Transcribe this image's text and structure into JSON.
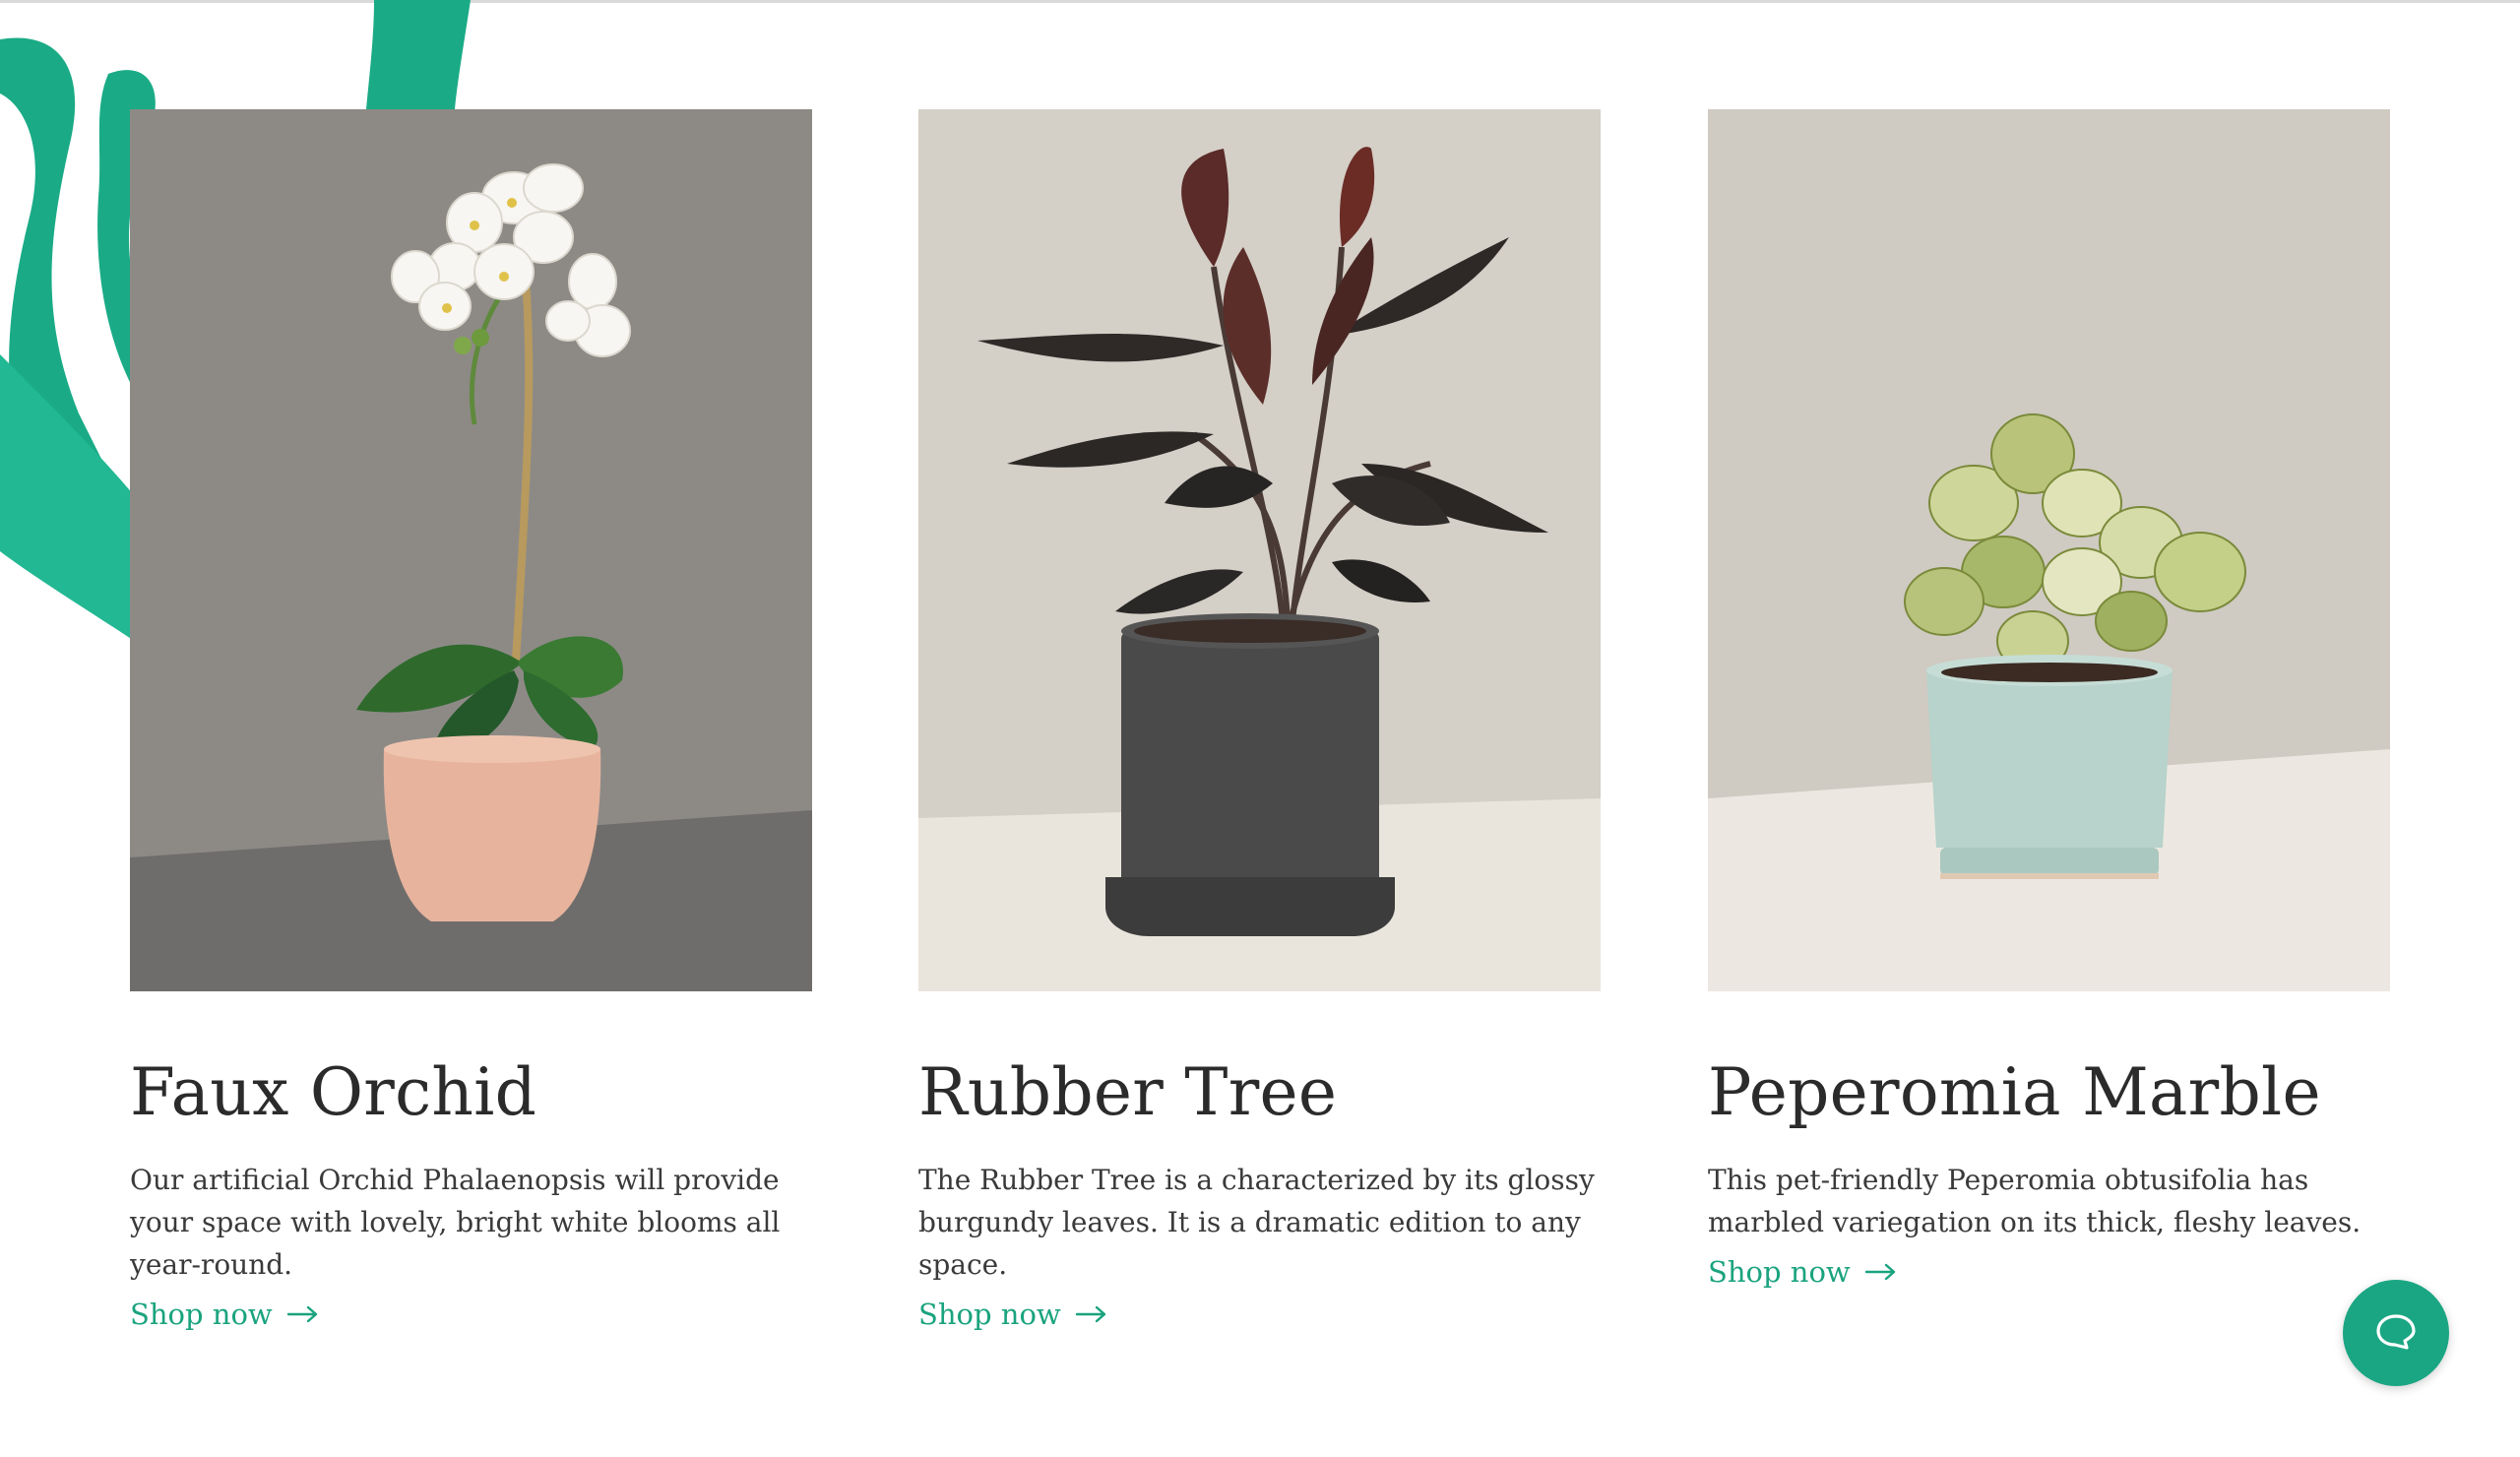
{
  "colors": {
    "accent": "#1aa37e",
    "decor_green": "#1aab86",
    "text": "#2b2b2b"
  },
  "products": [
    {
      "title": "Faux Orchid",
      "description": "Our artificial Orchid Phalaenopsis will provide your space with lovely, bright white blooms all year-round.",
      "link_label": "Shop now",
      "link_icon": "arrow-right-icon",
      "pot_color": "#e7b39d"
    },
    {
      "title": "Rubber Tree",
      "description": "The Rubber Tree is a characterized by its glossy burgundy leaves. It is a dramatic edition to any space.",
      "link_label": "Shop now",
      "link_icon": "arrow-right-icon",
      "pot_color": "#4a4a4a"
    },
    {
      "title": "Peperomia Marble",
      "description": "This pet-friendly Peperomia obtusifolia has marbled variegation on its thick, fleshy leaves.",
      "link_label": "Shop now",
      "link_icon": "arrow-right-icon",
      "pot_color": "#b7d3cb"
    }
  ],
  "chat_button": {
    "icon": "chat-bubble-icon"
  }
}
